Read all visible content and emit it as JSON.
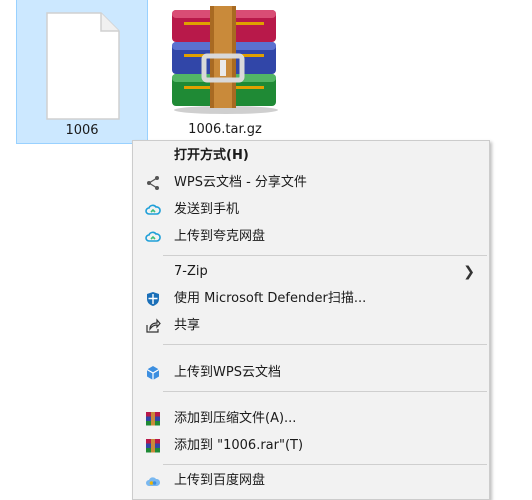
{
  "files": [
    {
      "name": "1006"
    },
    {
      "name": "1006.tar.gz"
    }
  ],
  "menu": {
    "open_with": "打开方式(H)",
    "wps_share": "WPS云文档 - 分享文件",
    "send_phone": "发送到手机",
    "upload_quark": "上传到夸克网盘",
    "seven_zip": "7-Zip",
    "defender": "使用 Microsoft Defender扫描...",
    "share": "共享",
    "upload_wps": "上传到WPS云文档",
    "add_archive": "添加到压缩文件(A)...",
    "add_rar": "添加到 \"1006.rar\"(T)",
    "upload_baidu": "上传到百度网盘"
  },
  "colors": {
    "selection_bg": "#cce8ff",
    "selection_border": "#99d1ff",
    "menu_bg": "#f2f2f2"
  }
}
